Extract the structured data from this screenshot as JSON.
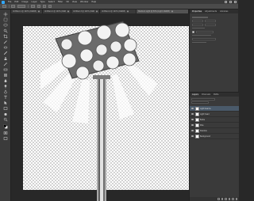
{
  "menubar": {
    "items": [
      "File",
      "Edit",
      "Image",
      "Layer",
      "Type",
      "Select",
      "Filter",
      "3D",
      "View",
      "Window",
      "Help"
    ]
  },
  "tabs": [
    {
      "label": "Untitled-1 @ 100% (RGB/8)",
      "active": false
    },
    {
      "label": "Untitled-2 @ 100% (RGB/8)",
      "active": false
    },
    {
      "label": "Untitled-3 @ 100% (RGB/8)",
      "active": false
    },
    {
      "label": "Untitled-4 @ 100% (RGB/8)",
      "active": false
    },
    {
      "label": "Stadium Light @ 50% (Light, RGB/8)",
      "active": true
    }
  ],
  "right_panel": {
    "tabs": [
      "Properties",
      "Adjustments",
      "Libraries"
    ],
    "active_tab": "Properties"
  },
  "layers_panel": {
    "tabs": [
      "Layers",
      "Channels",
      "Paths"
    ],
    "layers": [
      {
        "name": "Light beams",
        "selected": true
      },
      {
        "name": "Light head",
        "selected": false
      },
      {
        "name": "Bulbs",
        "selected": false
      },
      {
        "name": "Pole",
        "selected": false
      },
      {
        "name": "Shadow",
        "selected": false
      },
      {
        "name": "Background",
        "selected": false
      }
    ]
  },
  "colors": {
    "accent": "#31a8ff",
    "foreground_swatch": "#000000",
    "background_swatch": "#ffffff",
    "workspace": "#282828",
    "panel": "#3a3a3a"
  }
}
